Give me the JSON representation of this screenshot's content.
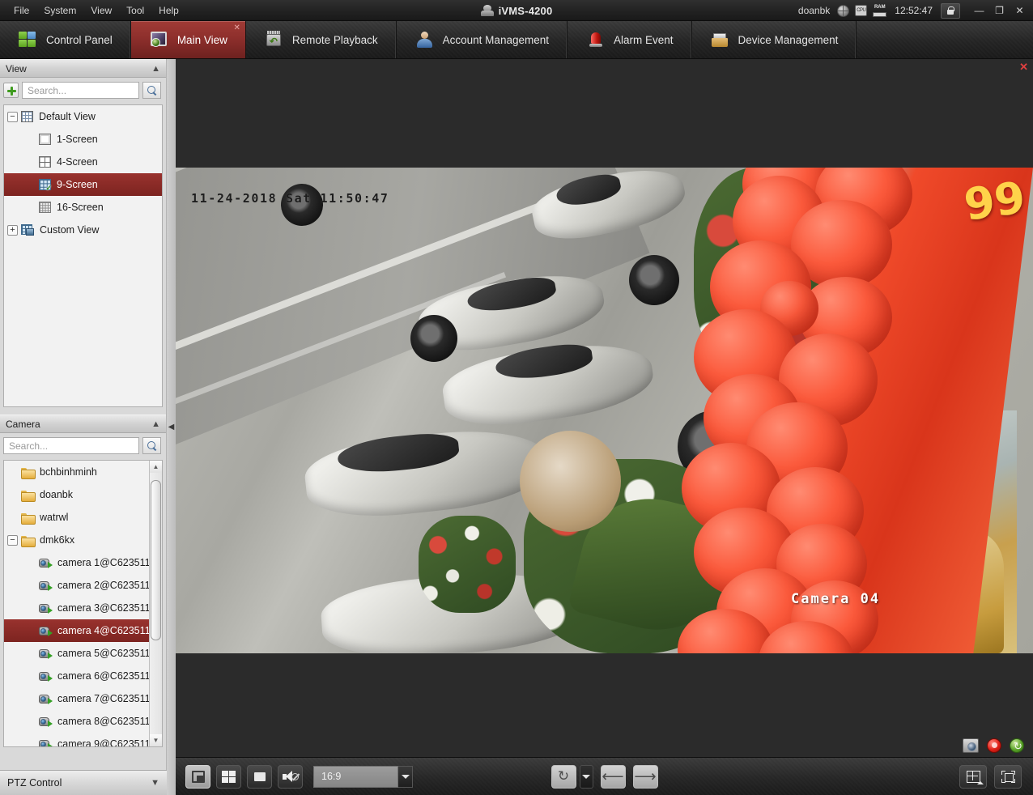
{
  "titlebar": {
    "menus": [
      "File",
      "System",
      "View",
      "Tool",
      "Help"
    ],
    "app_title": "iVMS-4200",
    "user": "doanbk",
    "time": "12:52:47",
    "status_icons": [
      "globe-icon",
      "cpu-icon",
      "ram-icon"
    ],
    "cpu_label": "CPU",
    "ram_label": "RAM",
    "lock_icon": "lock-icon",
    "minimize_label": "—",
    "maximize_label": "❐",
    "close_label": "✕"
  },
  "tabs": [
    {
      "label": "Control Panel",
      "icon": "control-panel-icon",
      "active": false
    },
    {
      "label": "Main View",
      "icon": "main-view-icon",
      "active": true,
      "close_label": "✕"
    },
    {
      "label": "Remote Playback",
      "icon": "remote-playback-icon",
      "active": false
    },
    {
      "label": "Account Management",
      "icon": "account-management-icon",
      "active": false
    },
    {
      "label": "Alarm Event",
      "icon": "alarm-event-icon",
      "active": false
    },
    {
      "label": "Device Management",
      "icon": "device-management-icon",
      "active": false
    }
  ],
  "view_panel": {
    "title": "View",
    "collapse_icon": "chevron-up-icon",
    "add_button_icon": "plus-icon",
    "search_placeholder": "Search...",
    "search_value": "",
    "search_button_icon": "search-icon",
    "tree": [
      {
        "label": "Default View",
        "icon": "grid-icon",
        "expander": "−",
        "indent": 0,
        "selected": false
      },
      {
        "label": "1-Screen",
        "icon": "screen-1-icon",
        "indent": 1,
        "selected": false
      },
      {
        "label": "4-Screen",
        "icon": "screen-4-icon",
        "indent": 1,
        "selected": false
      },
      {
        "label": "9-Screen",
        "icon": "screen-9-icon",
        "indent": 1,
        "selected": true
      },
      {
        "label": "16-Screen",
        "icon": "screen-16-icon",
        "indent": 1,
        "selected": false
      },
      {
        "label": "Custom View",
        "icon": "custom-view-icon",
        "expander": "+",
        "indent": 0,
        "selected": false
      }
    ]
  },
  "camera_panel": {
    "title": "Camera",
    "collapse_icon": "chevron-up-icon",
    "search_placeholder": "Search...",
    "search_value": "",
    "search_button_icon": "search-icon",
    "tree": [
      {
        "label": "bchbinhminh",
        "icon": "folder-icon",
        "indent": 0,
        "selected": false
      },
      {
        "label": "doanbk",
        "icon": "folder-icon",
        "indent": 0,
        "selected": false
      },
      {
        "label": "watrwl",
        "icon": "folder-icon",
        "indent": 0,
        "selected": false
      },
      {
        "label": "dmk6kx",
        "icon": "folder-icon",
        "expander": "−",
        "indent": 0,
        "selected": false
      },
      {
        "label": "camera 1@C623511...",
        "icon": "camera-icon",
        "indent": 1,
        "selected": false
      },
      {
        "label": "camera 2@C623511...",
        "icon": "camera-icon",
        "indent": 1,
        "selected": false
      },
      {
        "label": "camera 3@C623511...",
        "icon": "camera-icon",
        "indent": 1,
        "selected": false
      },
      {
        "label": "camera 4@C623511...",
        "icon": "camera-icon",
        "indent": 1,
        "selected": true
      },
      {
        "label": "camera 5@C623511...",
        "icon": "camera-icon",
        "indent": 1,
        "selected": false
      },
      {
        "label": "camera 6@C623511...",
        "icon": "camera-icon",
        "indent": 1,
        "selected": false
      },
      {
        "label": "camera 7@C623511...",
        "icon": "camera-icon",
        "indent": 1,
        "selected": false
      },
      {
        "label": "camera 8@C623511...",
        "icon": "camera-icon",
        "indent": 1,
        "selected": false
      },
      {
        "label": "camera 9@C623511...",
        "icon": "camera-icon",
        "indent": 1,
        "selected": false
      }
    ],
    "scrollbar": {
      "up_icon": "▲",
      "down_icon": "▼"
    }
  },
  "ptz_panel": {
    "title": "PTZ Control",
    "expand_icon": "chevron-down-icon"
  },
  "splitter": {
    "collapse_icon": "◀"
  },
  "viewport": {
    "close_label": "✕",
    "timestamp_overlay": "11-24-2018 Sat 11:50:47",
    "camera_label": "Camera 04",
    "banner_text": "99",
    "status_icons": [
      "snapshot-icon",
      "record-icon",
      "ptz-status-icon"
    ]
  },
  "bottom_toolbar": {
    "save_view_icon": "save-view-icon",
    "split_window_icon": "split-window-icon",
    "stop_all_icon": "stop-all-icon",
    "mute_icon": "mute-icon",
    "aspect_ratio_value": "16:9",
    "aspect_ratio_caret": "▼",
    "refresh_icon": "refresh-icon",
    "refresh_caret": "▼",
    "previous_icon": "arrow-left-icon",
    "next_icon": "arrow-right-icon",
    "layout_icon": "layout-grid-icon",
    "fullscreen_icon": "fullscreen-icon"
  }
}
